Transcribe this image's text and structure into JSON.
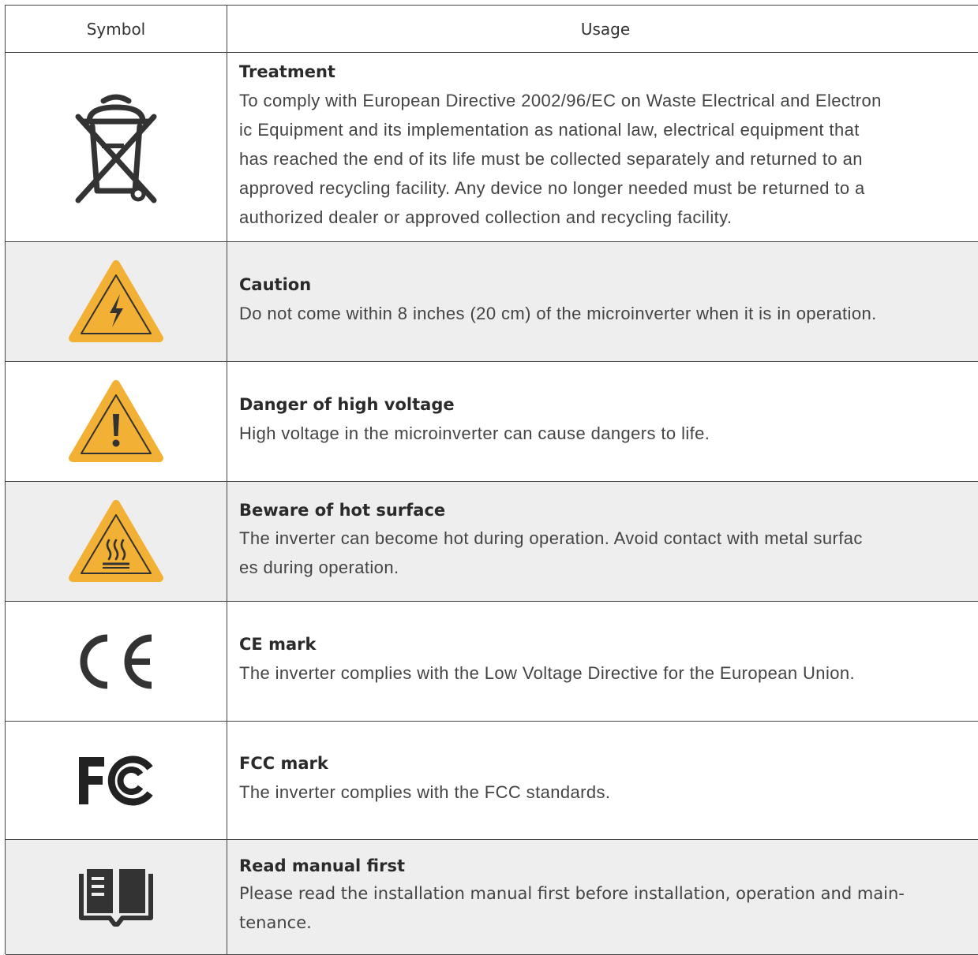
{
  "header": {
    "symbol": "Symbol",
    "usage": "Usage"
  },
  "rows": [
    {
      "icon": "weee-crossed-bin-icon",
      "title": "Treatment",
      "lines": [
        "To comply with European Directive 2002/96/EC on Waste Electrical and Electron",
        "ic Equipment and its implementation as national law, electrical equipment that",
        "has reached the end of its life must be collected separately and returned to an",
        "approved recycling facility. Any device no longer needed must be returned to a",
        "authorized dealer or approved collection and recycling facility."
      ]
    },
    {
      "icon": "electric-shock-warning-icon",
      "title": "Caution",
      "lines": [
        "Do not come within 8 inches (20 cm) of the microinverter when it is in operation."
      ]
    },
    {
      "icon": "exclamation-warning-icon",
      "title": "Danger of high voltage",
      "lines": [
        "High voltage in the microinverter can cause dangers to life."
      ]
    },
    {
      "icon": "hot-surface-warning-icon",
      "title": "Beware of hot surface",
      "lines": [
        "The inverter can become hot during operation. Avoid contact with metal surfac",
        "es during operation."
      ]
    },
    {
      "icon": "ce-mark-icon",
      "title": "CE mark",
      "lines": [
        "The inverter complies with the Low Voltage Directive for the European Union."
      ]
    },
    {
      "icon": "fcc-mark-icon",
      "title": "FCC mark",
      "lines": [
        "The inverter complies with the FCC standards."
      ]
    },
    {
      "icon": "read-manual-book-icon",
      "title": "Read manual first",
      "lines": [
        "Please read the installation manual first before installation, operation and main-",
        "tenance."
      ]
    }
  ],
  "colors": {
    "warning_fill": "#f2b035",
    "icon_dark": "#333333",
    "alt_row": "#eeeeee"
  }
}
